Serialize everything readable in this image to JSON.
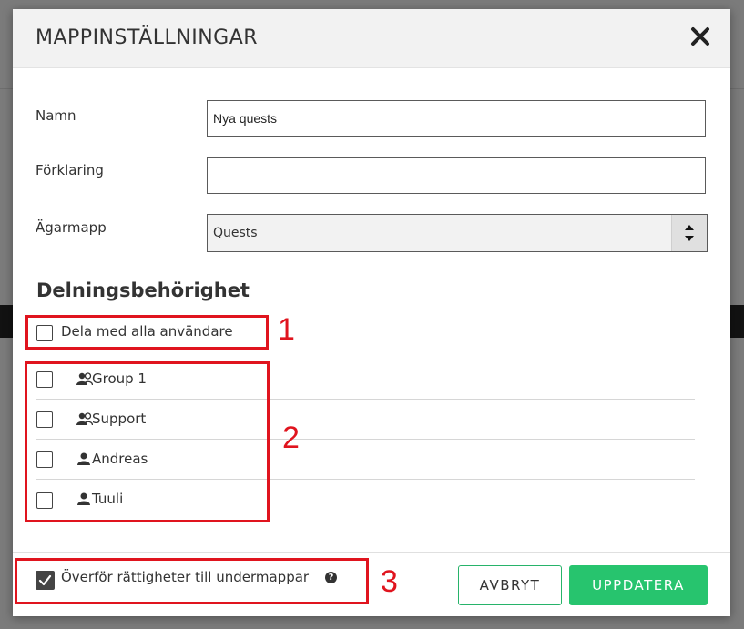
{
  "modal": {
    "title": "MAPPINSTÄLLNINGAR"
  },
  "form": {
    "name_label": "Namn",
    "name_value": "Nya quests",
    "description_label": "Förklaring",
    "description_value": "",
    "owner_label": "Ägarmapp",
    "owner_value": "Quests"
  },
  "sharing": {
    "title": "Delningsbehörighet",
    "share_all_label": "Dela med alla användare",
    "share_all_checked": false,
    "entries": [
      {
        "label": "Group 1",
        "icon": "group-icon",
        "checked": false
      },
      {
        "label": "Support",
        "icon": "group-icon",
        "checked": false
      },
      {
        "label": "Andreas",
        "icon": "user-icon",
        "checked": false
      },
      {
        "label": "Tuuli",
        "icon": "user-icon",
        "checked": false
      }
    ]
  },
  "footer": {
    "inherit_label": "Överför rättigheter till undermappar",
    "inherit_checked": true,
    "help_glyph": "?",
    "cancel_label": "AVBRYT",
    "update_label": "UPPDATERA"
  },
  "annotations": [
    "1",
    "2",
    "3"
  ],
  "colors": {
    "accent_green": "#27c46e",
    "annotation_red": "#e0141e"
  }
}
